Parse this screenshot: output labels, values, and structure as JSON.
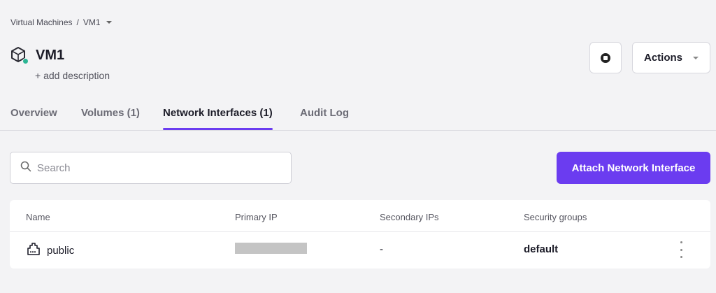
{
  "breadcrumb": {
    "parent": "Virtual Machines",
    "separator": "/",
    "current": "VM1"
  },
  "header": {
    "title": "VM1",
    "add_description": "+ add description",
    "status_color": "#2bb594"
  },
  "toolbar": {
    "actions_label": "Actions"
  },
  "tabs": [
    {
      "label": "Overview",
      "active": false
    },
    {
      "label": "Volumes (1)",
      "active": false
    },
    {
      "label": "Network Interfaces (1)",
      "active": true
    },
    {
      "label": "Audit Log",
      "active": false
    }
  ],
  "search": {
    "placeholder": "Search",
    "value": ""
  },
  "attach_button": {
    "label": "Attach Network Interface",
    "color": "#6b3cf0"
  },
  "table": {
    "columns": [
      "Name",
      "Primary IP",
      "Secondary IPs",
      "Security groups"
    ],
    "rows": [
      {
        "name": "public",
        "primary_ip": "",
        "secondary_ips": "-",
        "security_groups": "default"
      }
    ]
  },
  "icons": [
    "vm-cube-icon",
    "stop-icon",
    "chevron-down-icon",
    "search-icon",
    "network-interface-icon",
    "kebab-menu-icon"
  ]
}
